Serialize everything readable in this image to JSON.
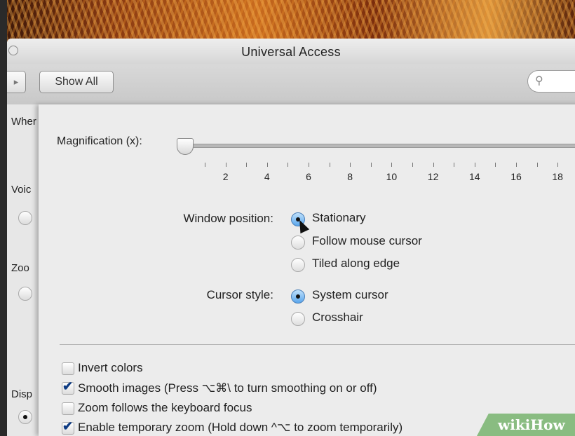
{
  "window": {
    "title": "Universal Access"
  },
  "toolbar": {
    "show_all_label": "Show All",
    "search_placeholder": ""
  },
  "left_panel": {
    "labels": [
      "Wher",
      "Voic",
      "Zoo",
      "Disp"
    ]
  },
  "zoom_options": {
    "magnification_label": "Magnification (x):",
    "magnification_value": 1,
    "tick_labels": [
      "2",
      "4",
      "6",
      "8",
      "10",
      "12",
      "14",
      "16",
      "18"
    ],
    "window_position": {
      "label": "Window position:",
      "options": [
        "Stationary",
        "Follow mouse cursor",
        "Tiled along edge"
      ],
      "selected": "Stationary"
    },
    "cursor_style": {
      "label": "Cursor style:",
      "options": [
        "System cursor",
        "Crosshair"
      ],
      "selected": "System cursor"
    },
    "checkboxes": [
      {
        "label": "Invert colors",
        "checked": false
      },
      {
        "label": "Smooth images (Press ⌥⌘\\ to turn smoothing on or off)",
        "checked": true
      },
      {
        "label": "Zoom follows the keyboard focus",
        "checked": false
      },
      {
        "label": "Enable temporary zoom (Hold down ^⌥ to zoom temporarily)",
        "checked": true
      }
    ]
  },
  "watermark": {
    "text": "wikiHow"
  }
}
